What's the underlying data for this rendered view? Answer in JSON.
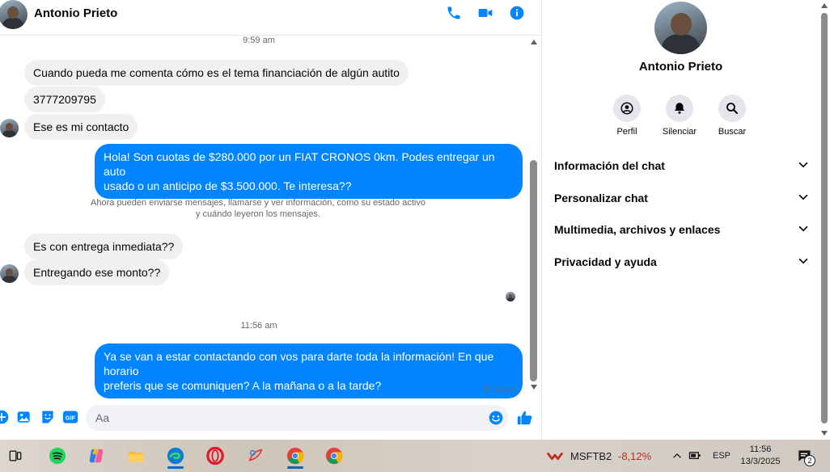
{
  "header": {
    "contact_name": "Antonio Prieto",
    "icons": [
      "phone-icon",
      "video-camera-icon",
      "info-icon"
    ],
    "accent_color": "#0084ff"
  },
  "messages": {
    "timestamp_1": "9:59 am",
    "m1": "Cuando pueda me comenta cómo es el tema financiación de algún autito",
    "m2": "3777209795",
    "m3": "Ese es mi contacto",
    "m4_line1": "Hola! Son cuotas de $280.000 por un FIAT CRONOS 0km. Podes entregar un auto",
    "m4_line2": "usado o un anticipo de $3.500.000. Te interesa??",
    "notice_line1": "Ahora pueden enviarse mensajes, llamarse y ver información, como su estado activo",
    "notice_line2": "y cuándo leyeron los mensajes.",
    "m5": "Es con entrega inmediata??",
    "m6": "Entregando ese monto??",
    "timestamp_2": "11:56 am",
    "m7_line1": "Ya se van a estar contactando con vos para darte toda la información! En que horario",
    "m7_line2": "preferis que se comuniquen? A la mañana o a la tarde?",
    "status": "Enviado"
  },
  "composer": {
    "placeholder": "Aa",
    "icons": [
      "plus-icon",
      "image-icon",
      "sticker-icon",
      "gif-icon",
      "emoji-icon",
      "thumbs-up-icon"
    ],
    "gif_label": "GIF"
  },
  "panel": {
    "name": "Antonio Prieto",
    "actions": [
      {
        "label": "Perfil",
        "icon": "profile-icon"
      },
      {
        "label": "Silenciar",
        "icon": "bell-icon"
      },
      {
        "label": "Buscar",
        "icon": "search-icon"
      }
    ],
    "sections": [
      "Información del chat",
      "Personalizar chat",
      "Multimedia, archivos y enlaces",
      "Privacidad y ayuda"
    ]
  },
  "taskbar": {
    "ticker_name": "MSFTB2",
    "ticker_value": "-8,12%",
    "language": "ESP",
    "time": "11:56",
    "date": "13/3/2025",
    "notification_count": "2"
  }
}
